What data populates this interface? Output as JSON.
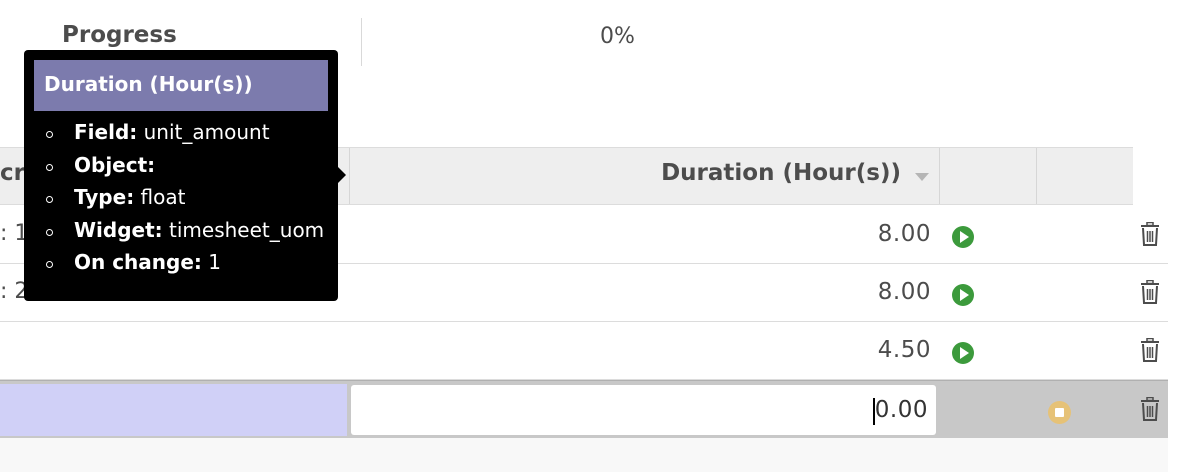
{
  "form": {
    "progress_label": "Progress",
    "progress_value": "0%"
  },
  "table": {
    "col1_header_clip": "cr",
    "duration_header": "Duration (Hour(s))",
    "rows": [
      {
        "clip_text": ": 1",
        "duration": "8.00"
      },
      {
        "clip_text": ": 2",
        "duration": "8.00"
      },
      {
        "clip_text": "",
        "duration": "4.50"
      }
    ],
    "edit_row": {
      "duration_value": "0.00"
    }
  },
  "tooltip": {
    "title": "Duration (Hour(s))",
    "items": [
      {
        "key": "Field:",
        "value": " unit_amount"
      },
      {
        "key": "Object:",
        "value": ""
      },
      {
        "key": "Type:",
        "value": " float"
      },
      {
        "key": "Widget:",
        "value": " timesheet_uom"
      },
      {
        "key": "On change:",
        "value": " 1"
      }
    ]
  },
  "colors": {
    "play_icon": "#3c9a3c",
    "stop_icon": "#e6c277",
    "tooltip_header": "#7c7bad",
    "edit_cell_highlight": "#d0d0f7"
  },
  "icons": {
    "row_start": "play-icon",
    "row_delete": "trash-icon",
    "edit_stop": "stop-icon",
    "sort": "caret-down-icon"
  }
}
